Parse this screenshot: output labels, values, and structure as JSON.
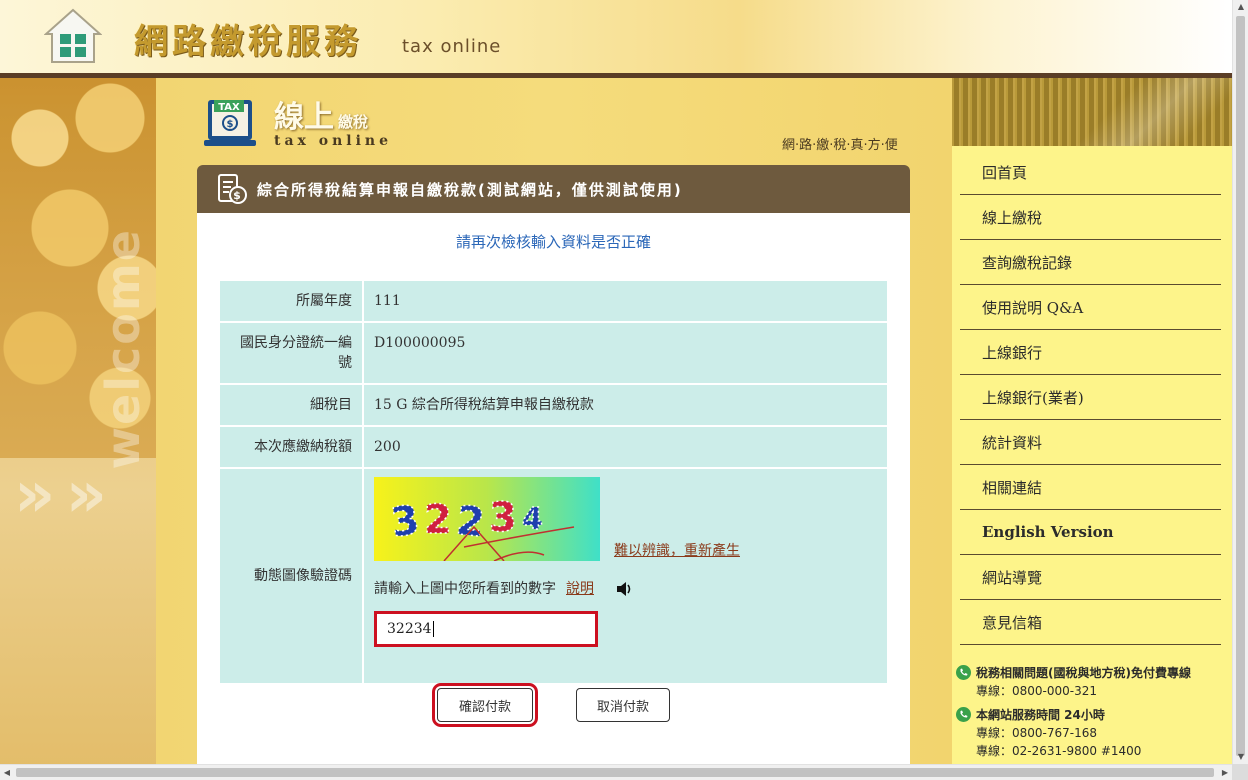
{
  "header": {
    "title": "網路繳稅服務",
    "subtitle": "tax online"
  },
  "section": {
    "title": "線上",
    "title_small": "繳稅",
    "subtitle": "tax online",
    "slogan": "網·路·繳·稅·真·方·便",
    "welcome": "welcome"
  },
  "panel": {
    "heading": "綜合所得稅結算申報自繳稅款(測試網站，僅供測試使用)",
    "check_message": "請再次檢核輸入資料是否正確"
  },
  "details": {
    "year_label": "所屬年度",
    "year_value": "111",
    "id_label": "國民身分證統一編號",
    "id_value": "D100000095",
    "item_label": "細稅目",
    "item_value": "15 G 綜合所得稅結算申報自繳稅款",
    "amount_label": "本次應繳納稅額",
    "amount_value": "200",
    "captcha_label": "動態圖像驗證碼"
  },
  "captcha": {
    "image_text": "32234",
    "regenerate_link": "難以辨識，重新產生",
    "hint": "請輸入上圖中您所看到的數字",
    "explain_link": "說明",
    "input_value": "32234"
  },
  "buttons": {
    "confirm": "確認付款",
    "cancel": "取消付款"
  },
  "sidebar": {
    "items": [
      {
        "label": "回首頁"
      },
      {
        "label": "線上繳稅"
      },
      {
        "label": "查詢繳稅記錄"
      },
      {
        "label": "使用說明 Q&A"
      },
      {
        "label": "上線銀行"
      },
      {
        "label": "上線銀行(業者)"
      },
      {
        "label": "統計資料"
      },
      {
        "label": "相關連結"
      },
      {
        "label": "English Version"
      },
      {
        "label": "網站導覽"
      },
      {
        "label": "意見信箱"
      }
    ],
    "contact": {
      "hotline_title": "稅務相關問題(國稅與地方稅)免付費專線",
      "hotline_number": "專線：0800-000-321",
      "service_title": "本網站服務時間 24小時",
      "service_line1": "專線：0800-767-168",
      "service_line2": "專線：02-2631-9800 #1400"
    }
  },
  "colors": {
    "panel_header": "#6e5a3e",
    "table_cell": "#ccede9",
    "sidebar_bg": "#fdf48a",
    "highlight_red": "#cc1020",
    "link_blue": "#2b67b8"
  }
}
